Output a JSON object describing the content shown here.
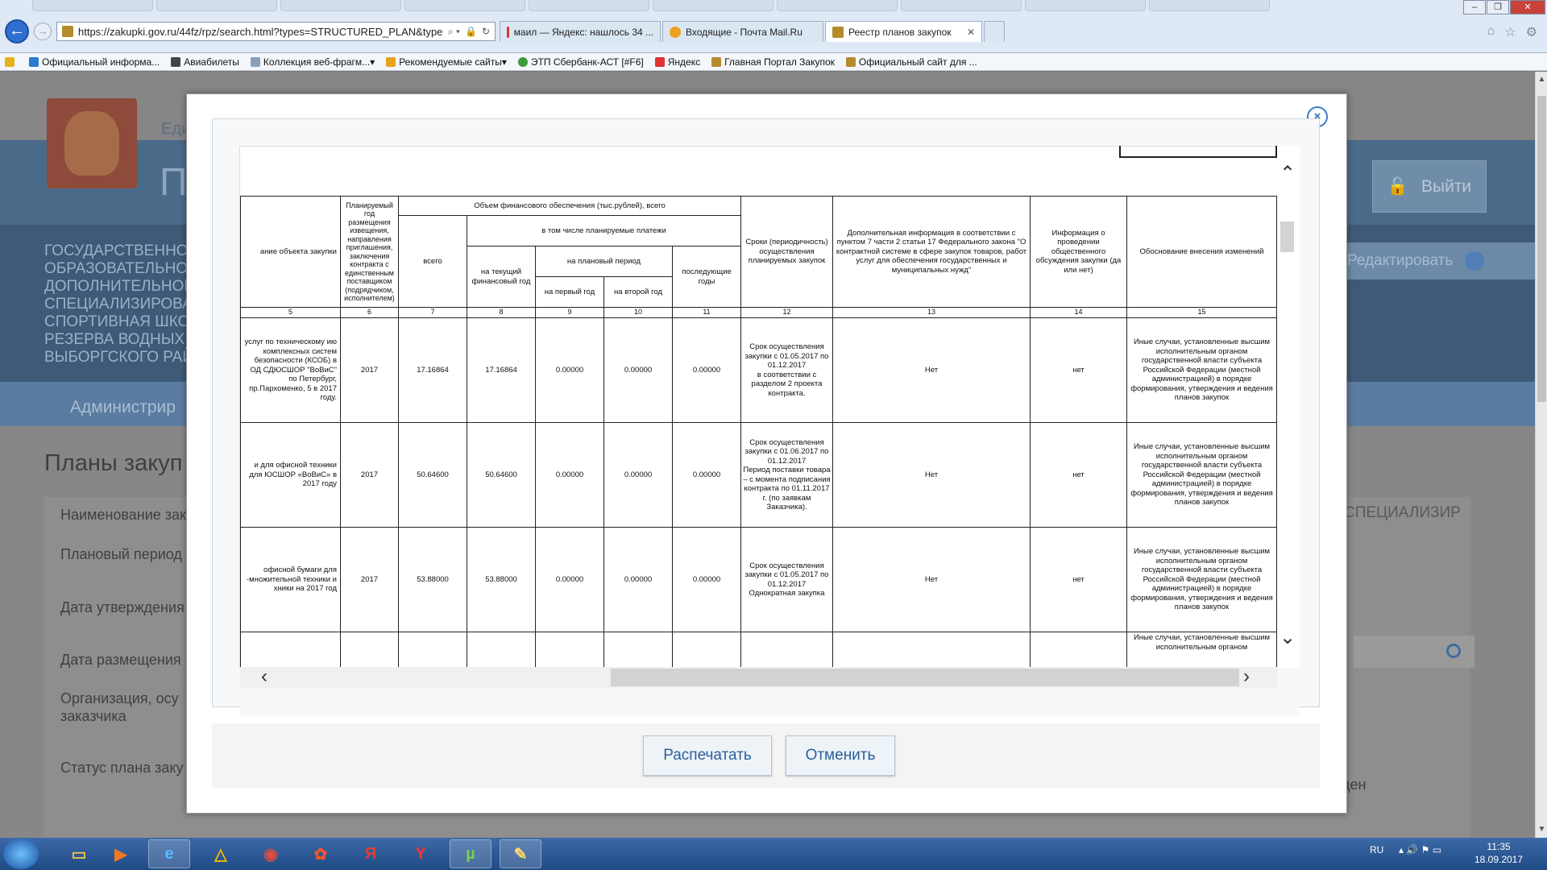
{
  "browser": {
    "url": "https://zakupki.gov.ru/44fz/rpz/search.html?types=STRUCTURED_PLAN&types=UNS",
    "tabs": [
      {
        "label": "маил — Яндекс: нашлось 34 ...",
        "active": false
      },
      {
        "label": "Входящие - Почта Mail.Ru",
        "active": false
      },
      {
        "label": "Реестр планов закупок",
        "active": true
      }
    ],
    "favorites": [
      "Официальный информа...",
      "Авиабилеты",
      "Коллекция веб-фрагм...",
      "Рекомендуемые сайты",
      "ЭТП Сбербанк-АСТ [#F6]",
      "Яндекс",
      "Главная Портал Закупок",
      "Официальный сайт для ..."
    ]
  },
  "page": {
    "header_ed": "Еди",
    "header_big": "П",
    "logout": "Выйти",
    "org_lines": "ГОСУДАРСТВЕННОЕ\nОБРАЗОВАТЕЛЬНОЕ\nДОПОЛНИТЕЛЬНОГО\nСПЕЦИАЛИЗИРОВАН\nСПОРТИВНАЯ ШКОЛ\nРЕЗЕРВА ВОДНЫХ И\nВЫБОРГСКОГО РАЙО",
    "edit": "Редактировать",
    "admin": "Администрир",
    "plans_title": "Планы закуп",
    "labels": [
      "Наименование зак",
      "Плановый период",
      "Дата утверждения",
      "Дата размещения",
      "Организация, осу\nзаказчика",
      "Статус плана заку"
    ],
    "right_caption": "СПЕЦИАЛИЗИР",
    "right_den": "ден"
  },
  "modal": {
    "close": "×",
    "headers": {
      "object": "ание объекта закупки",
      "year": "Планируемый год размещения извещения, направления приглашения, заключения контракта с единственным поставщиком (подрядчиком, исполнителем)",
      "finance": "Объем финансового обеспечения (тыс.рублей), всего",
      "total": "всего",
      "incl": "в том числе планируемые платежи",
      "current": "на текущий финансовый год",
      "planned": "на плановый период",
      "first": "на первый год",
      "second": "на второй год",
      "later": "последующие годы",
      "terms": "Сроки (периодичность) осуществления планируемых закупок",
      "additional": "Дополнительная информация в соответствии с пунктом 7 части 2 статьи 17 Федерального закона \"О контрактной системе в сфере закупок товаров, работ услуг для обеспечения государственных и муниципальных нужд\"",
      "discussion": "Информация о проведении общественного обсуждения закупки (да или нет)",
      "justification": "Обоснование внесения изменений"
    },
    "col_numbers": [
      "5",
      "6",
      "7",
      "8",
      "9",
      "10",
      "11",
      "12",
      "13",
      "14",
      "15"
    ],
    "rows": [
      {
        "object": "услуг по техническому ию комплексных систем безопасности (КСОБ) в ОД СДЮСШОР \"ВоВиС\" по Петербург, пр.Пархоменко, 5 в 2017 году.",
        "year": "2017",
        "total": "17.16864",
        "current": "17.16864",
        "first": "0.00000",
        "second": "0.00000",
        "later": "0.00000",
        "terms": "Срок осуществления закупки с 01.05.2017 по 01.12.2017\nв соответствии с разделом 2 проекта контракта.",
        "additional": "Нет",
        "discussion": "нет",
        "justification": "Иные случаи, установленные высшим исполнительным органом государственной власти субъекта Российской Федерации (местной администрацией) в порядке формирования, утверждения и ведения планов закупок"
      },
      {
        "object": "и для офисной техники для ЮСШОР «ВоВиС» в 2017 году",
        "year": "2017",
        "total": "50.64600",
        "current": "50.64600",
        "first": "0.00000",
        "second": "0.00000",
        "later": "0.00000",
        "terms": "Срок осуществления закупки с 01.06.2017 по 01.12.2017\nПериод поставки товара – с момента подписания контракта по 01.11.2017 г. (по заявкам Заказчика).",
        "additional": "Нет",
        "discussion": "нет",
        "justification": "Иные случаи, установленные высшим исполнительным органом государственной власти субъекта Российской Федерации (местной администрацией) в порядке формирования, утверждения и ведения планов закупок"
      },
      {
        "object": "офисной бумаги для -множительной техники и хники на 2017 год",
        "year": "2017",
        "total": "53.88000",
        "current": "53.88000",
        "first": "0.00000",
        "second": "0.00000",
        "later": "0.00000",
        "terms": "Срок осуществления закупки с 01.05.2017 по 01.12.2017\nОднократная закупка",
        "additional": "Нет",
        "discussion": "нет",
        "justification": "Иные случаи, установленные высшим исполнительным органом государственной власти субъекта Российской Федерации (местной администрацией) в порядке формирования, утверждения и ведения планов закупок"
      },
      {
        "object": "",
        "year": "",
        "total": "",
        "current": "",
        "first": "",
        "second": "",
        "later": "",
        "terms": "",
        "additional": "",
        "discussion": "",
        "justification": "Иные случаи, установленные высшим исполнительным органом"
      }
    ],
    "print_button": "Распечатать",
    "cancel_button": "Отменить"
  },
  "taskbar": {
    "lang": "RU",
    "time": "11:35",
    "date": "18.09.2017"
  }
}
